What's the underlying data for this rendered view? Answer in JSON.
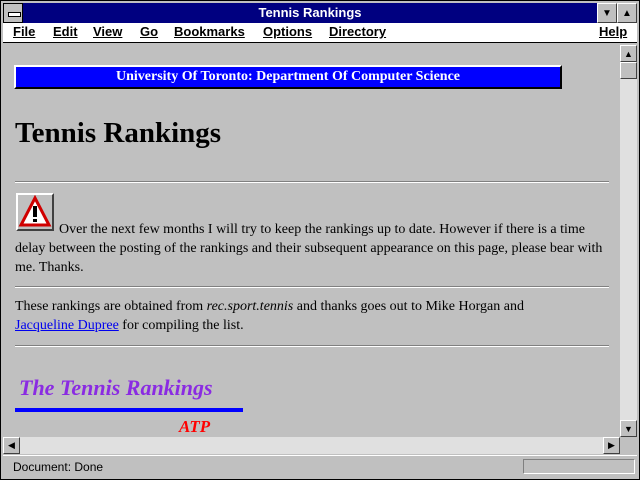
{
  "window": {
    "title": "Tennis Rankings"
  },
  "menubar": {
    "items": [
      {
        "label": "File"
      },
      {
        "label": "Edit"
      },
      {
        "label": "View"
      },
      {
        "label": "Go"
      },
      {
        "label": "Bookmarks"
      },
      {
        "label": "Options"
      },
      {
        "label": "Directory"
      }
    ],
    "help": "Help"
  },
  "page": {
    "banner": "University Of Toronto: Department Of Computer Science",
    "heading": "Tennis Rankings",
    "notice_text": " Over the next few months I will try to keep the rankings up to date. However if there is a time delay between the posting of the rankings and their subsequent appearance on this page, please bear with me. Thanks.",
    "credits": {
      "prefix": "These rankings are obtained from ",
      "source": "rec.sport.tennis",
      "middle": " and thanks goes out to Mike Horgan and",
      "link": "Jacqueline Dupree",
      "suffix": " for compiling the list."
    },
    "section_title": "The Tennis Rankings",
    "subsection": "ATP"
  },
  "status": {
    "text": "Document: Done"
  },
  "colors": {
    "titlebar": "#000080",
    "banner": "#0000ff",
    "section_title": "#8a2be2",
    "subsection": "#ff0000",
    "link": "#0000ee"
  },
  "icons": {
    "notice": "warning-icon",
    "system": "system-menu-icon",
    "minimize": "minimize-icon",
    "maximize": "maximize-icon"
  }
}
